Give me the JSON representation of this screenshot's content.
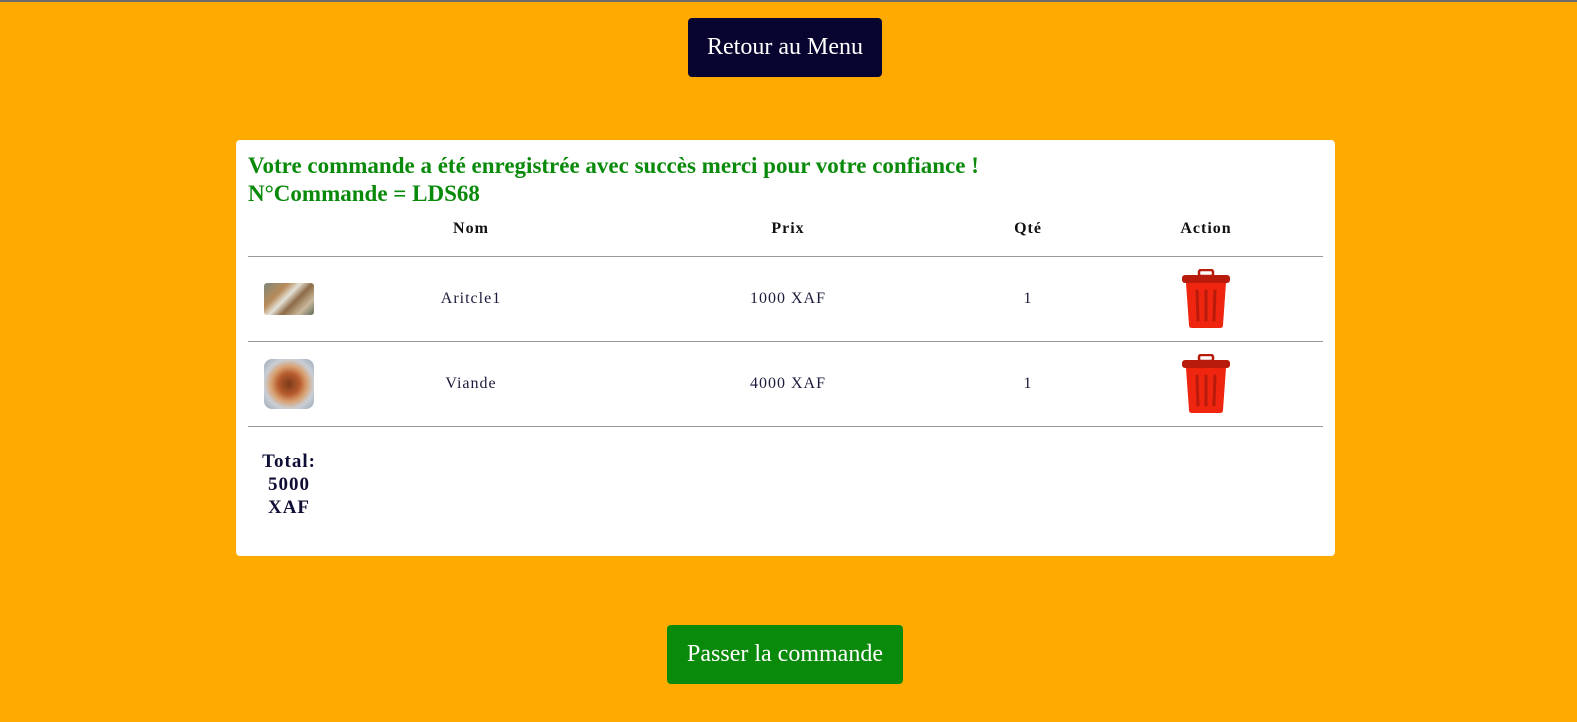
{
  "header": {
    "back_button_label": "Retour au Menu"
  },
  "order": {
    "success_message": "Votre commande a été enregistrée avec succès merci pour votre confiance !",
    "order_number_line": "N°Commande = LDS68"
  },
  "table": {
    "columns": [
      "",
      "Nom",
      "Prix",
      "Qté",
      "Action"
    ],
    "rows": [
      {
        "image": "food-thumbnail-1",
        "nom": "Aritcle1",
        "prix": "1000 XAF",
        "qte": "1",
        "action_icon": "trash-icon"
      },
      {
        "image": "food-thumbnail-2",
        "nom": "Viande",
        "prix": "4000 XAF",
        "qte": "1",
        "action_icon": "trash-icon"
      }
    ]
  },
  "total": {
    "label": "Total:",
    "amount": "5000",
    "currency": "XAF"
  },
  "footer": {
    "order_button_label": "Passer la commande"
  },
  "colors": {
    "background": "#FFAA00",
    "menu_button": "#07052F",
    "success_green": "#0A8A0A",
    "trash_red": "#F0250F"
  }
}
